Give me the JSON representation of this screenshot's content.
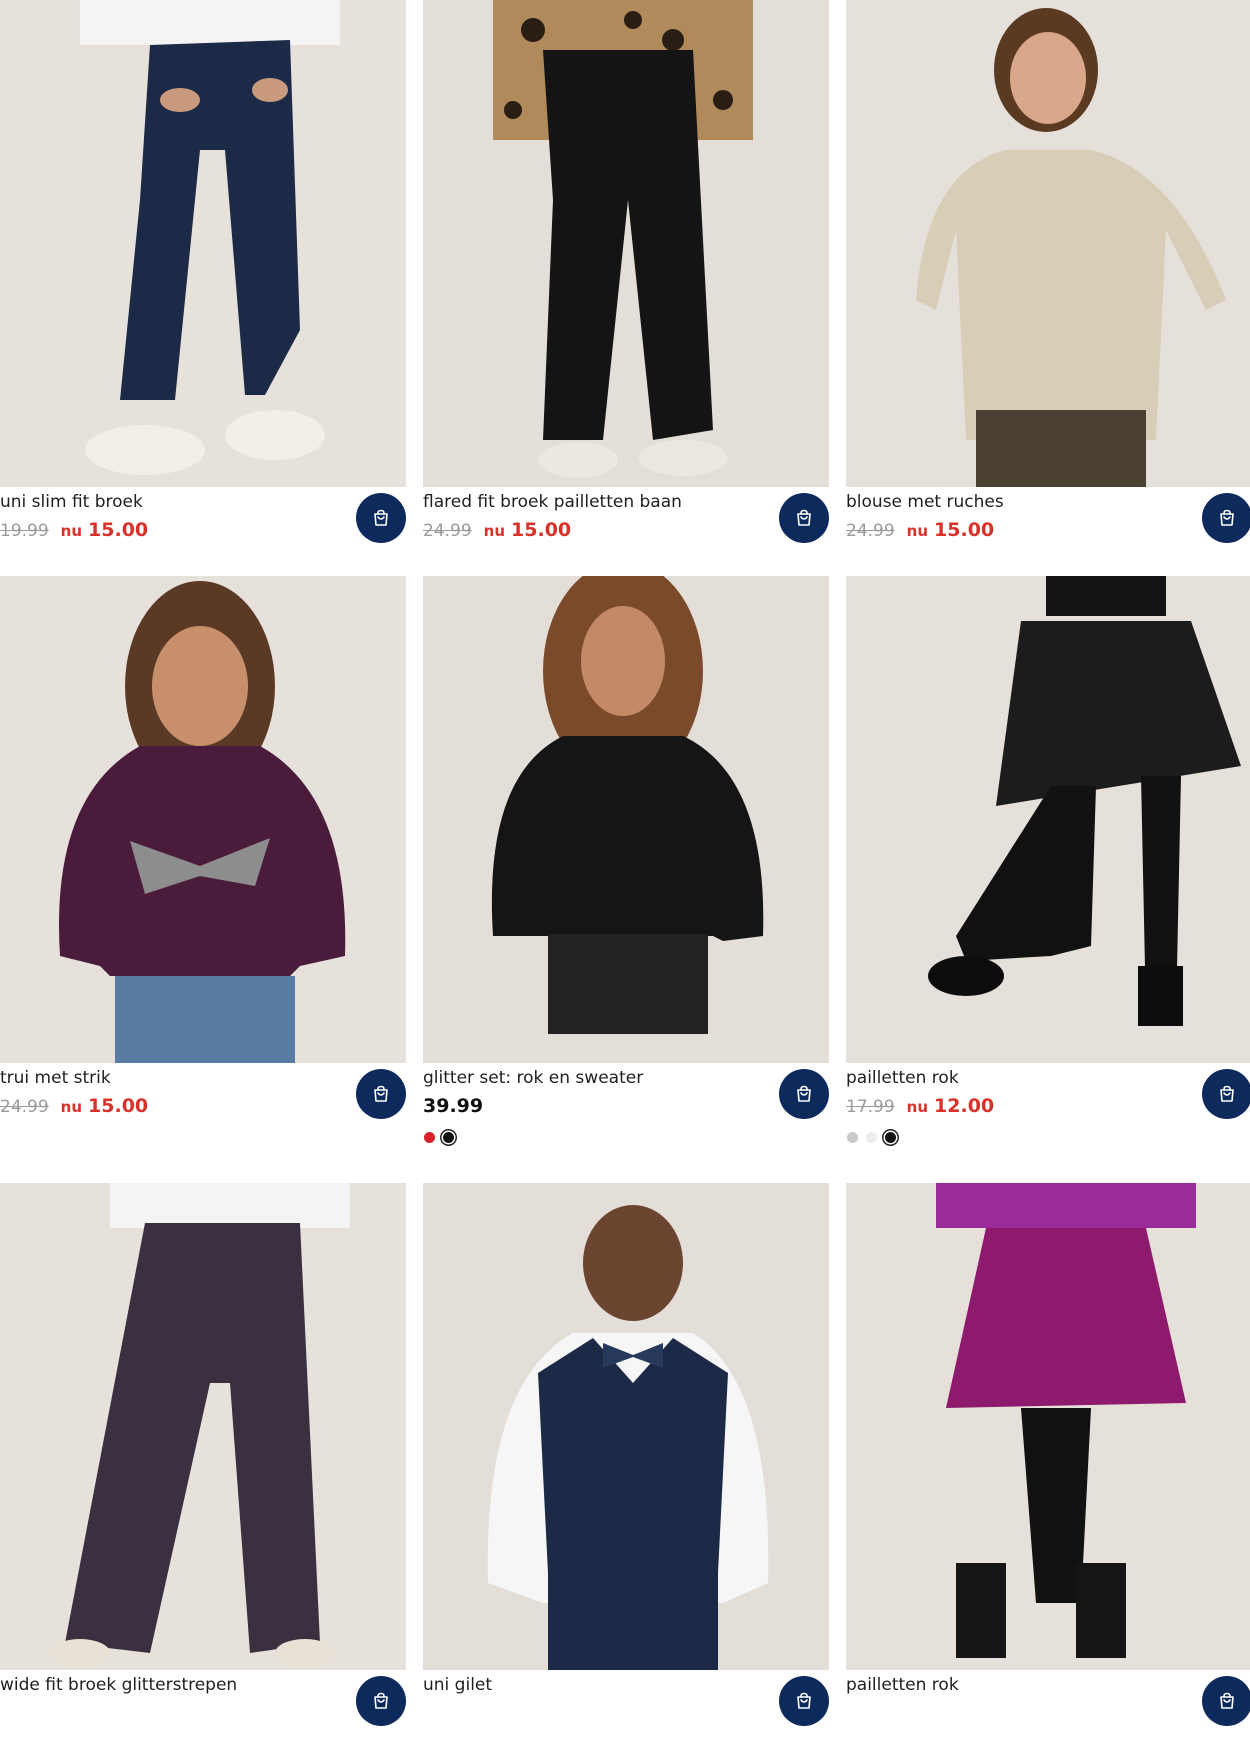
{
  "products": [
    {
      "name": "uni slim fit broek",
      "old_price": "19.99",
      "now_label": "nu",
      "price": "15.00",
      "cart_icon": "shopping-bag-icon"
    },
    {
      "name": "flared fit broek pailletten baan",
      "old_price": "24.99",
      "now_label": "nu",
      "price": "15.00",
      "cart_icon": "shopping-bag-icon"
    },
    {
      "name": "blouse met ruches",
      "old_price": "24.99",
      "now_label": "nu",
      "price": "15.00",
      "cart_icon": "shopping-bag-icon"
    },
    {
      "name": "trui met strik",
      "old_price": "24.99",
      "now_label": "nu",
      "price": "15.00",
      "cart_icon": "shopping-bag-icon"
    },
    {
      "name": "glitter set: rok en sweater",
      "price": "39.99",
      "swatches": [
        "#d8222a",
        "#111111"
      ],
      "selected_swatch": 1,
      "cart_icon": "shopping-bag-icon"
    },
    {
      "name": "pailletten rok",
      "old_price": "17.99",
      "now_label": "nu",
      "price": "12.00",
      "swatches": [
        "#c8c8c8",
        "#ececec",
        "#111111"
      ],
      "selected_swatch": 2,
      "cart_icon": "shopping-bag-icon"
    },
    {
      "name": "wide fit broek glitterstrepen",
      "cart_icon": "shopping-bag-icon"
    },
    {
      "name": "uni gilet",
      "cart_icon": "shopping-bag-icon"
    },
    {
      "name": "pailletten rok",
      "cart_icon": "shopping-bag-icon"
    }
  ],
  "colors": {
    "cart_button": "#0c2a5c",
    "sale_red": "#d8322a",
    "photo_background": "#e6e0da"
  }
}
